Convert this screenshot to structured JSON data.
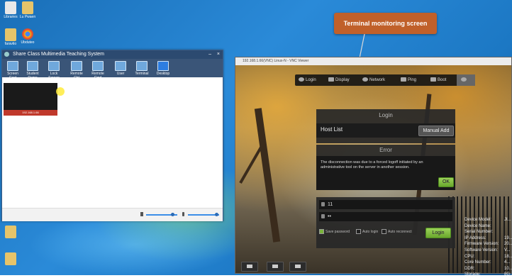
{
  "desktop": {
    "icons": [
      {
        "name": "libraries-icon",
        "label": "Libraries",
        "color": "#e8e8e8"
      },
      {
        "name": "folder-icon",
        "label": "Lu Pwaen",
        "color": "#e6c46a"
      },
      {
        "name": "folder-icon-2",
        "label": "faravtio",
        "color": "#e6c46a"
      },
      {
        "name": "chrome-icon",
        "label": "Ubduteo",
        "color": "#e74c3c"
      }
    ]
  },
  "teaching_window": {
    "title": "Share Class Multimedia Teaching System",
    "toolbar": [
      {
        "label": "Screen Cast"
      },
      {
        "label": "Student Demo"
      },
      {
        "label": "Lock Screen"
      },
      {
        "label": "Remote Ctrl"
      },
      {
        "label": "Remote Cmd"
      },
      {
        "label": "User"
      },
      {
        "label": "Terminal"
      },
      {
        "label": "Desktop"
      }
    ],
    "thumb_label": "192.168.1.66",
    "volume_fill": 0.85,
    "mic_fill": 0.9
  },
  "vnc": {
    "title": "192.168.1.66(VNC) Linux-N - VNC Viewer",
    "toolbar": [
      {
        "label": "Login"
      },
      {
        "label": "Display"
      },
      {
        "label": "Network"
      },
      {
        "label": "Ping"
      },
      {
        "label": "Boot"
      }
    ],
    "login_title": "Login",
    "host_list_label": "Host List",
    "manual_add_label": "Manual Add",
    "error_title": "Error",
    "error_message": "The disconnection was due to a forced logoff initiated by an administrative tool on the server in another session.",
    "ok_label": "OK",
    "username_value": "11",
    "password_value": "••",
    "save_password_label": "Save password",
    "auto_login_label": "Auto login",
    "auto_reconnect_label": "Auto reconnect",
    "login_button": "Login",
    "device_info": [
      {
        "key": "Device Model:",
        "val": "JI..."
      },
      {
        "key": "Device Name:",
        "val": ""
      },
      {
        "key": "Serial Number:",
        "val": ""
      },
      {
        "key": "IP Address:",
        "val": "19..."
      },
      {
        "key": "Firmware Version:",
        "val": "20..."
      },
      {
        "key": "Software Version:",
        "val": "V..."
      },
      {
        "key": "CPU:",
        "val": "18..."
      },
      {
        "key": "Core Number:",
        "val": "4..."
      },
      {
        "key": "DDR:",
        "val": "10..."
      },
      {
        "key": "Storage:",
        "val": "8G..."
      }
    ]
  },
  "callout": {
    "text": "Terminal monitoring screen"
  }
}
